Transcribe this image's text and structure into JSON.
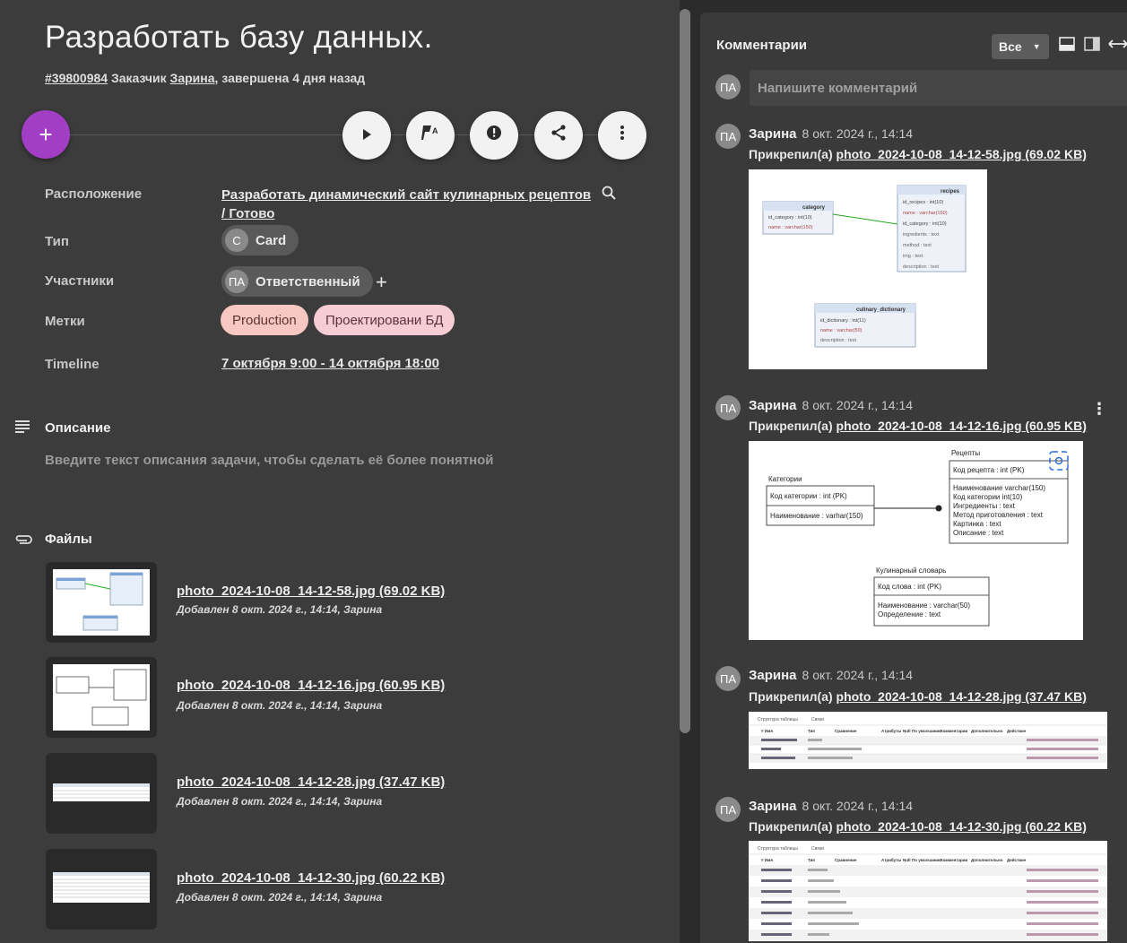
{
  "task": {
    "title": "Разработать базу данных.",
    "id": "#39800984",
    "customer_prefix": "Заказчик",
    "customer": "Зарина",
    "status_text": ", завершена 4 дня назад"
  },
  "actions": {
    "add_label": "+",
    "play_icon": "play-icon",
    "flag_icon": "flag-auto-icon",
    "alert_icon": "alert-icon",
    "share_icon": "share-icon",
    "more_icon": "more-vertical-icon"
  },
  "properties": {
    "location_label": "Расположение",
    "location_value": "Разработать динамический сайт кулинарных рецептов",
    "location_value2": "/ Готово",
    "type_label": "Тип",
    "type_avatar": "C",
    "type_value": "Card",
    "members_label": "Участники",
    "members_avatar": "ПА",
    "members_value": "Ответственный",
    "members_add": "+",
    "tags_label": "Метки",
    "tags": [
      "Production",
      "Проектировани БД"
    ],
    "timeline_label": "Timeline",
    "timeline_value": "7 октября 9:00 - 14 октября 18:00"
  },
  "description": {
    "heading": "Описание",
    "placeholder": "Введите текст описания задачи, чтобы сделать её более понятной"
  },
  "files": {
    "heading": "Файлы",
    "items": [
      {
        "name": "photo_2024-10-08_14-12-58.jpg (69.02 KB)",
        "meta": "Добавлен 8 окт. 2024 г., 14:14, Зарина"
      },
      {
        "name": "photo_2024-10-08_14-12-16.jpg (60.95 KB)",
        "meta": "Добавлен 8 окт. 2024 г., 14:14, Зарина"
      },
      {
        "name": "photo_2024-10-08_14-12-28.jpg (37.47 KB)",
        "meta": "Добавлен 8 окт. 2024 г., 14:14, Зарина"
      },
      {
        "name": "photo_2024-10-08_14-12-30.jpg (60.22 KB)",
        "meta": "Добавлен 8 окт. 2024 г., 14:14, Зарина"
      }
    ]
  },
  "comments": {
    "heading": "Комментарии",
    "filter": "Все",
    "avatar": "ПА",
    "input_placeholder": "Напишите комментарий",
    "items": [
      {
        "author": "Зарина",
        "date": "8 окт. 2024 г., 14:14",
        "attach_prefix": "Прикрепил(а)",
        "file": "photo_2024-10-08_14-12-58.jpg (69.02 KB)"
      },
      {
        "author": "Зарина",
        "date": "8 окт. 2024 г., 14:14",
        "attach_prefix": "Прикрепил(а)",
        "file": "photo_2024-10-08_14-12-16.jpg (60.95 KB)"
      },
      {
        "author": "Зарина",
        "date": "8 окт. 2024 г., 14:14",
        "attach_prefix": "Прикрепил(а)",
        "file": "photo_2024-10-08_14-12-28.jpg (37.47 KB)"
      },
      {
        "author": "Зарина",
        "date": "8 окт. 2024 г., 14:14",
        "attach_prefix": "Прикрепил(а)",
        "file": "photo_2024-10-08_14-12-30.jpg (60.22 KB)"
      }
    ]
  },
  "diagram1": {
    "category_title": "category",
    "category_fields": [
      "id_category : int(10)",
      "name : varchar(150)"
    ],
    "recipes_title": "recipes",
    "recipes_fields": [
      "id_recipes : int(10)",
      "name : varchar(150)",
      "id_category : int(10)",
      "ingredients : text",
      "method : text",
      "img : text",
      "description : text"
    ],
    "dict_title": "culinary_dictionary",
    "dict_fields": [
      "id_dictionary : int(11)",
      "name : varchar(50)",
      "description : text"
    ]
  },
  "diagram2": {
    "cat_title": "Категории",
    "cat_pk": "Код категории : int (PK)",
    "cat_field": "Наименование : varhar(150)",
    "rec_title": "Рецепты",
    "rec_pk": "Код рецепта : int (PK)",
    "rec_fields": [
      "Наименование varchar(150)",
      "Код категории int(10)",
      "Ингредиенты : text",
      "Метод приготовления : text",
      "Картинка : text",
      "Описание : text"
    ],
    "dict_title": "Кулинарный словарь",
    "dict_pk": "Код слова : int (PK)",
    "dict_fields": [
      "Наименование : varchar(50)",
      "Определение : text"
    ]
  },
  "table_shot": {
    "tab1": "Структура таблицы",
    "tab2": "Связи",
    "headers": [
      "# Имя",
      "Тип",
      "Сравнение",
      "Атрибуты",
      "Null",
      "По умолчанию",
      "Комментарии",
      "Дополнительно",
      "Действие"
    ]
  },
  "colors": {
    "fab": "#a13ec4",
    "tag1": "#f7c7c2",
    "tag2": "#f7cdd5",
    "panel": "#3c3c3c"
  }
}
